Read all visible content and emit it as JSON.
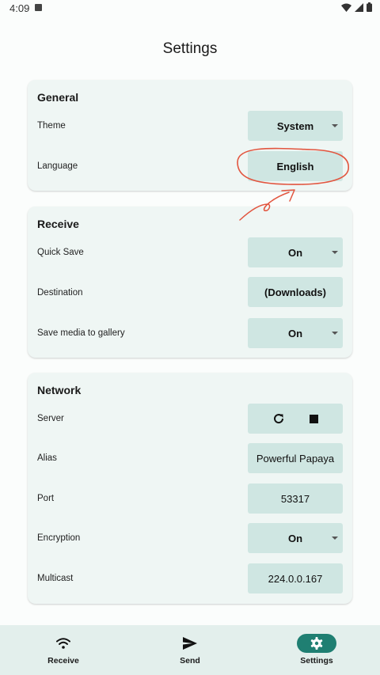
{
  "status_bar": {
    "time": "4:09"
  },
  "page": {
    "title": "Settings"
  },
  "general": {
    "title": "General",
    "theme_label": "Theme",
    "theme_value": "System",
    "language_label": "Language",
    "language_value": "English"
  },
  "receive": {
    "title": "Receive",
    "quick_save_label": "Quick Save",
    "quick_save_value": "On",
    "destination_label": "Destination",
    "destination_value": "(Downloads)",
    "save_media_label": "Save media to gallery",
    "save_media_value": "On"
  },
  "network": {
    "title": "Network",
    "server_label": "Server",
    "alias_label": "Alias",
    "alias_value": "Powerful Papaya",
    "port_label": "Port",
    "port_value": "53317",
    "encryption_label": "Encryption",
    "encryption_value": "On",
    "multicast_label": "Multicast",
    "multicast_value": "224.0.0.167"
  },
  "bottom_nav": {
    "items": [
      {
        "label": "Receive",
        "icon": "wifi-icon",
        "active": false
      },
      {
        "label": "Send",
        "icon": "send-icon",
        "active": false
      },
      {
        "label": "Settings",
        "icon": "gear-icon",
        "active": true
      }
    ]
  },
  "colors": {
    "accent": "#1f7f72",
    "control_bg": "#cfe6e2",
    "card_bg": "#eff6f4",
    "annotation": "#e2553f"
  }
}
